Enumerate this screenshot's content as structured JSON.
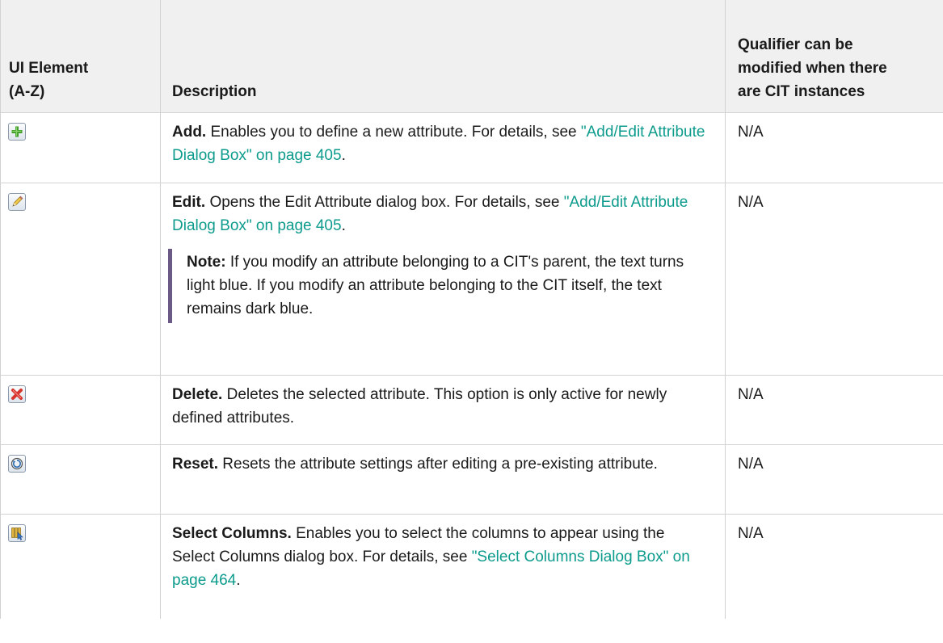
{
  "headers": {
    "ui_element": "UI Element (A-Z)",
    "ui_element_line1": "UI Element",
    "ui_element_line2": "(A-Z)",
    "description": "Description",
    "qualifier_line1": "Qualifier can be",
    "qualifier_line2": "modified when there",
    "qualifier_line3": "are CIT instances"
  },
  "rows": [
    {
      "icon": "add-icon",
      "term": "Add.",
      "text": " Enables you to define a new attribute. For details, see ",
      "link": "\"Add/Edit Attribute Dialog Box\" on page 405",
      "tail": ".",
      "qualifier": "N/A"
    },
    {
      "icon": "edit-pencil-icon",
      "term": "Edit.",
      "text": " Opens the Edit Attribute dialog box. For details, see ",
      "link": "\"Add/Edit Attribute Dialog Box\" on page 405",
      "tail": ".",
      "note_term": "Note:",
      "note_text": "  If you modify an attribute belonging to a CIT's parent, the text turns light blue. If you modify an attribute belonging to the CIT itself, the text remains dark blue.",
      "qualifier": "N/A"
    },
    {
      "icon": "delete-x-icon",
      "term": "Delete.",
      "text": " Deletes the selected attribute. This option is only active for newly defined attributes.",
      "qualifier": "N/A"
    },
    {
      "icon": "reset-icon",
      "term": "Reset.",
      "text": " Resets the attribute settings after editing a pre-existing attribute.",
      "qualifier": "N/A"
    },
    {
      "icon": "select-columns-icon",
      "term": "Select Columns.",
      "text": " Enables you to select the columns to appear using the Select Columns dialog box. For details, see ",
      "link": "\"Select Columns Dialog Box\" on page 464",
      "tail": ".",
      "qualifier": "N/A"
    }
  ],
  "colors": {
    "link": "#0c9b8c",
    "header_bg": "#f0f0f0",
    "border": "#d2d2d2",
    "note_bar": "#6b5a85"
  }
}
